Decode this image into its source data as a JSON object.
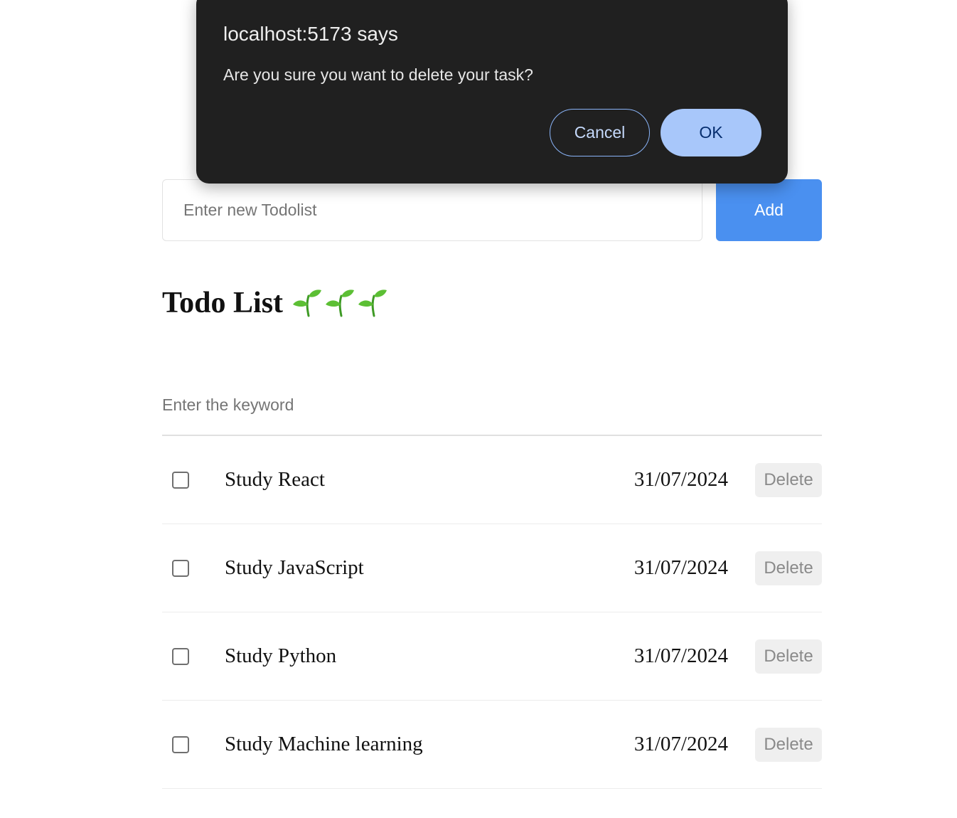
{
  "new_todo": {
    "placeholder": "Enter new Todolist",
    "add_label": "Add"
  },
  "header": {
    "title": "Todo List",
    "emoji_icons": [
      "seedling-icon",
      "seedling-icon",
      "seedling-icon"
    ]
  },
  "search": {
    "placeholder": "Enter the keyword"
  },
  "todos": [
    {
      "text": "Study React",
      "date": "31/07/2024",
      "checked": false,
      "delete_label": "Delete"
    },
    {
      "text": "Study JavaScript",
      "date": "31/07/2024",
      "checked": false,
      "delete_label": "Delete"
    },
    {
      "text": "Study Python",
      "date": "31/07/2024",
      "checked": false,
      "delete_label": "Delete"
    },
    {
      "text": "Study Machine learning",
      "date": "31/07/2024",
      "checked": false,
      "delete_label": "Delete"
    }
  ],
  "dialog": {
    "title": "localhost:5173 says",
    "message": "Are you sure you want to delete your task?",
    "cancel_label": "Cancel",
    "ok_label": "OK"
  },
  "colors": {
    "add_button": "#4a90f0",
    "dialog_background": "#202020",
    "ok_button": "#a8c7fa",
    "cancel_border": "#8ab4f8",
    "seedling_green": "#4caf2e"
  }
}
